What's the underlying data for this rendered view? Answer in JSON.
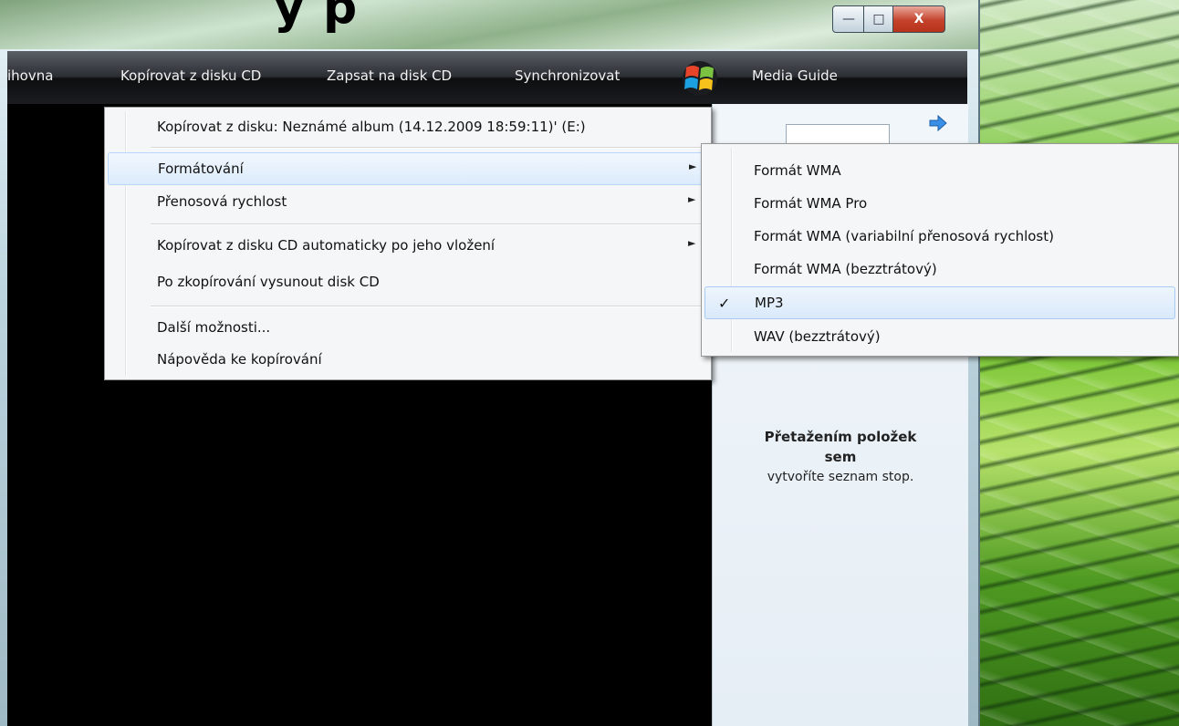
{
  "window": {
    "title_fragment": "y p",
    "minimize_glyph": "—",
    "maximize_glyph": "□",
    "close_glyph": "X"
  },
  "navbar": {
    "items": [
      {
        "label": "ihovna"
      },
      {
        "label": "Kopírovat z disku CD"
      },
      {
        "label": "Zapsat na disk CD"
      },
      {
        "label": "Synchronizovat"
      },
      {
        "label": "Media Guide"
      }
    ],
    "logo_icon": "windows-flag-icon"
  },
  "rip_menu": {
    "items": [
      {
        "label": "Kopírovat z disku: Neznámé album (14.12.2009 18:59:11)' (E:)",
        "has_submenu": false
      },
      {
        "label": "Formátování",
        "has_submenu": true,
        "highlighted": true
      },
      {
        "label": "Přenosová rychlost",
        "has_submenu": true
      },
      {
        "label": "Kopírovat z disku CD automaticky po jeho vložení",
        "has_submenu": true
      },
      {
        "label": "Po zkopírování vysunout disk CD",
        "has_submenu": false
      },
      {
        "label": "Další možnosti...",
        "has_submenu": false
      },
      {
        "label": "Nápověda ke kopírování",
        "has_submenu": false
      }
    ],
    "submenu_arrow": "►"
  },
  "format_submenu": {
    "items": [
      {
        "label": "Formát WMA",
        "checked": false
      },
      {
        "label": "Formát WMA Pro",
        "checked": false
      },
      {
        "label": "Formát WMA (variabilní přenosová rychlost)",
        "checked": false
      },
      {
        "label": "Formát WMA (bezztrátový)",
        "checked": false
      },
      {
        "label": "MP3",
        "checked": true
      },
      {
        "label": "WAV (bezztrátový)",
        "checked": false
      }
    ],
    "check_glyph": "✓"
  },
  "list_pane": {
    "hint_bold_line1": "Přetažením položek",
    "hint_bold_line2": "sem",
    "hint_sub": "vytvoříte seznam stop."
  },
  "colors": {
    "accent_highlight": "#dcebfc",
    "navbar_dark": "#0d0e10",
    "close_red": "#c4422b"
  }
}
